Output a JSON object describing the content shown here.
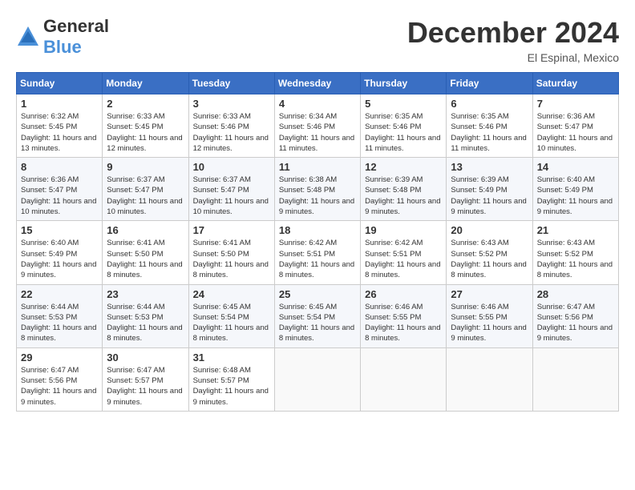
{
  "header": {
    "logo_general": "General",
    "logo_blue": "Blue",
    "month_title": "December 2024",
    "location": "El Espinal, Mexico"
  },
  "days_of_week": [
    "Sunday",
    "Monday",
    "Tuesday",
    "Wednesday",
    "Thursday",
    "Friday",
    "Saturday"
  ],
  "weeks": [
    [
      {
        "day": "1",
        "sunrise": "6:32 AM",
        "sunset": "5:45 PM",
        "daylight": "11 hours and 13 minutes."
      },
      {
        "day": "2",
        "sunrise": "6:33 AM",
        "sunset": "5:45 PM",
        "daylight": "11 hours and 12 minutes."
      },
      {
        "day": "3",
        "sunrise": "6:33 AM",
        "sunset": "5:46 PM",
        "daylight": "11 hours and 12 minutes."
      },
      {
        "day": "4",
        "sunrise": "6:34 AM",
        "sunset": "5:46 PM",
        "daylight": "11 hours and 11 minutes."
      },
      {
        "day": "5",
        "sunrise": "6:35 AM",
        "sunset": "5:46 PM",
        "daylight": "11 hours and 11 minutes."
      },
      {
        "day": "6",
        "sunrise": "6:35 AM",
        "sunset": "5:46 PM",
        "daylight": "11 hours and 11 minutes."
      },
      {
        "day": "7",
        "sunrise": "6:36 AM",
        "sunset": "5:47 PM",
        "daylight": "11 hours and 10 minutes."
      }
    ],
    [
      {
        "day": "8",
        "sunrise": "6:36 AM",
        "sunset": "5:47 PM",
        "daylight": "11 hours and 10 minutes."
      },
      {
        "day": "9",
        "sunrise": "6:37 AM",
        "sunset": "5:47 PM",
        "daylight": "11 hours and 10 minutes."
      },
      {
        "day": "10",
        "sunrise": "6:37 AM",
        "sunset": "5:47 PM",
        "daylight": "11 hours and 10 minutes."
      },
      {
        "day": "11",
        "sunrise": "6:38 AM",
        "sunset": "5:48 PM",
        "daylight": "11 hours and 9 minutes."
      },
      {
        "day": "12",
        "sunrise": "6:39 AM",
        "sunset": "5:48 PM",
        "daylight": "11 hours and 9 minutes."
      },
      {
        "day": "13",
        "sunrise": "6:39 AM",
        "sunset": "5:49 PM",
        "daylight": "11 hours and 9 minutes."
      },
      {
        "day": "14",
        "sunrise": "6:40 AM",
        "sunset": "5:49 PM",
        "daylight": "11 hours and 9 minutes."
      }
    ],
    [
      {
        "day": "15",
        "sunrise": "6:40 AM",
        "sunset": "5:49 PM",
        "daylight": "11 hours and 9 minutes."
      },
      {
        "day": "16",
        "sunrise": "6:41 AM",
        "sunset": "5:50 PM",
        "daylight": "11 hours and 8 minutes."
      },
      {
        "day": "17",
        "sunrise": "6:41 AM",
        "sunset": "5:50 PM",
        "daylight": "11 hours and 8 minutes."
      },
      {
        "day": "18",
        "sunrise": "6:42 AM",
        "sunset": "5:51 PM",
        "daylight": "11 hours and 8 minutes."
      },
      {
        "day": "19",
        "sunrise": "6:42 AM",
        "sunset": "5:51 PM",
        "daylight": "11 hours and 8 minutes."
      },
      {
        "day": "20",
        "sunrise": "6:43 AM",
        "sunset": "5:52 PM",
        "daylight": "11 hours and 8 minutes."
      },
      {
        "day": "21",
        "sunrise": "6:43 AM",
        "sunset": "5:52 PM",
        "daylight": "11 hours and 8 minutes."
      }
    ],
    [
      {
        "day": "22",
        "sunrise": "6:44 AM",
        "sunset": "5:53 PM",
        "daylight": "11 hours and 8 minutes."
      },
      {
        "day": "23",
        "sunrise": "6:44 AM",
        "sunset": "5:53 PM",
        "daylight": "11 hours and 8 minutes."
      },
      {
        "day": "24",
        "sunrise": "6:45 AM",
        "sunset": "5:54 PM",
        "daylight": "11 hours and 8 minutes."
      },
      {
        "day": "25",
        "sunrise": "6:45 AM",
        "sunset": "5:54 PM",
        "daylight": "11 hours and 8 minutes."
      },
      {
        "day": "26",
        "sunrise": "6:46 AM",
        "sunset": "5:55 PM",
        "daylight": "11 hours and 8 minutes."
      },
      {
        "day": "27",
        "sunrise": "6:46 AM",
        "sunset": "5:55 PM",
        "daylight": "11 hours and 9 minutes."
      },
      {
        "day": "28",
        "sunrise": "6:47 AM",
        "sunset": "5:56 PM",
        "daylight": "11 hours and 9 minutes."
      }
    ],
    [
      {
        "day": "29",
        "sunrise": "6:47 AM",
        "sunset": "5:56 PM",
        "daylight": "11 hours and 9 minutes."
      },
      {
        "day": "30",
        "sunrise": "6:47 AM",
        "sunset": "5:57 PM",
        "daylight": "11 hours and 9 minutes."
      },
      {
        "day": "31",
        "sunrise": "6:48 AM",
        "sunset": "5:57 PM",
        "daylight": "11 hours and 9 minutes."
      },
      null,
      null,
      null,
      null
    ]
  ]
}
